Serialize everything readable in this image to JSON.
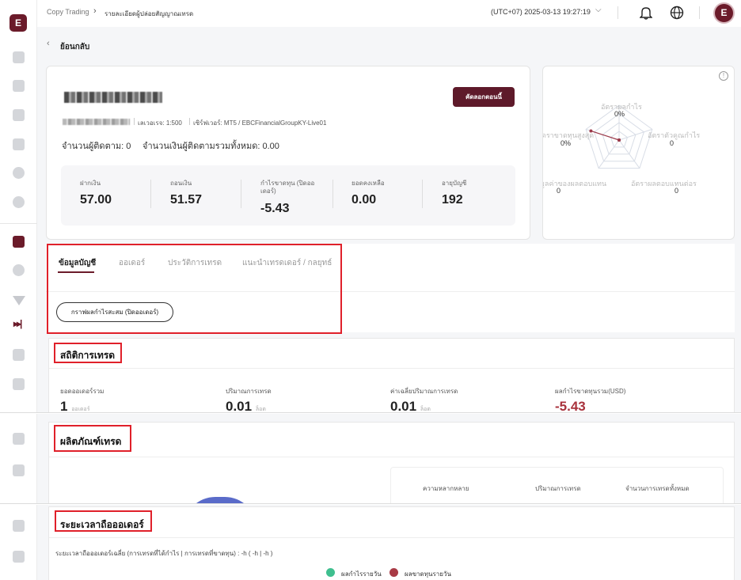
{
  "topbar": {
    "breadcrumb_root": "Copy Trading",
    "breadcrumb_current": "รายละเอียดผู้ปล่อยสัญญาณเทรด",
    "clock": "(UTC+07)  2025-03-13 19:27:19",
    "avatar_text": "E"
  },
  "sidebar": {
    "logo_text": "E"
  },
  "back": {
    "label": "ย้อนกลับ"
  },
  "profile": {
    "leverage": "เลเวอเรจ: 1:500",
    "server": "เซิร์ฟเวอร์: MT5 / EBCFinancialGroupKY-Live01",
    "followers": "จำนวนผู้ติดตาม: 0",
    "follow_amount": "จำนวนเงินผู้ติดตามรวมทั้งหมด: 0.00",
    "copy_button": "คัดลอกตอนนี้",
    "stats": [
      {
        "label": "ฝากเงิน",
        "value": "57.00"
      },
      {
        "label": "ถอนเงิน",
        "value": "51.57"
      },
      {
        "label": "กำไรขาดทุน (ปิดออเดอร์)",
        "value": "-5.43"
      },
      {
        "label": "ยอดคงเหลือ",
        "value": "0.00"
      },
      {
        "label": "อายุบัญชี",
        "value": "192"
      }
    ]
  },
  "radar": {
    "info": "!",
    "axes": [
      {
        "label": "อัตราผลกำไร",
        "value": "0%",
        "level": 0
      },
      {
        "label": "อัตราตัวคูณกำไร",
        "value": "0",
        "level": 0
      },
      {
        "label": "อัตราผลตอบแทนต่อร",
        "value": "0",
        "level": 0
      },
      {
        "label": "มูลค่าของผลตอบแทน",
        "value": "0",
        "level": 0
      },
      {
        "label": "ดราขาดทุนสูงสุด",
        "value": "0%",
        "level": 0.85
      }
    ],
    "colors": {
      "fill": "#f3dfe3",
      "stroke": "#9c3b4b",
      "grid": "#d8dde6"
    }
  },
  "tabs": {
    "items": [
      {
        "label": "ข้อมูลบัญชี"
      },
      {
        "label": "ออเดอร์"
      },
      {
        "label": "ประวัติการเทรด"
      },
      {
        "label": "แนะนำเทรดเดอร์ / กลยุทธ์"
      }
    ],
    "chart_button": "กราฟผลกำไรสะสม (ปิดออเดอร์)"
  },
  "trade_stats": {
    "title": "สถิติการเทรด",
    "items": [
      {
        "label": "ยอดออเดอร์รวม",
        "value": "1",
        "unit": "ออเดอร์"
      },
      {
        "label": "ปริมาณการเทรด",
        "value": "0.01",
        "unit": "ล็อต"
      },
      {
        "label": "ค่าเฉลี่ยปริมาณการเทรด",
        "value": "0.01",
        "unit": "ล็อต"
      },
      {
        "label": "ผลกำไรขาดทุนรวม(USD)",
        "value": "-5.43",
        "unit": ""
      }
    ]
  },
  "products": {
    "title": "ผลิตภัณฑ์เทรด",
    "columns": [
      "ความหลากหลาย",
      "ปริมาณการเทรด",
      "จำนวนการเทรดทั้งหมด"
    ]
  },
  "duration": {
    "title": "ระยะเวลาถือออเดอร์",
    "description": "ระยะเวลาถือออเดอร์เฉลี่ย (การเทรดที่ได้กำไร | การเทรดที่ขาดทุน) : -h ( -h | -h )",
    "legend": [
      {
        "label": "ผลกำไรรายวัน",
        "color": "#3fbf8f"
      },
      {
        "label": "ผลขาดทุนรายวัน",
        "color": "#a83a45"
      }
    ]
  }
}
